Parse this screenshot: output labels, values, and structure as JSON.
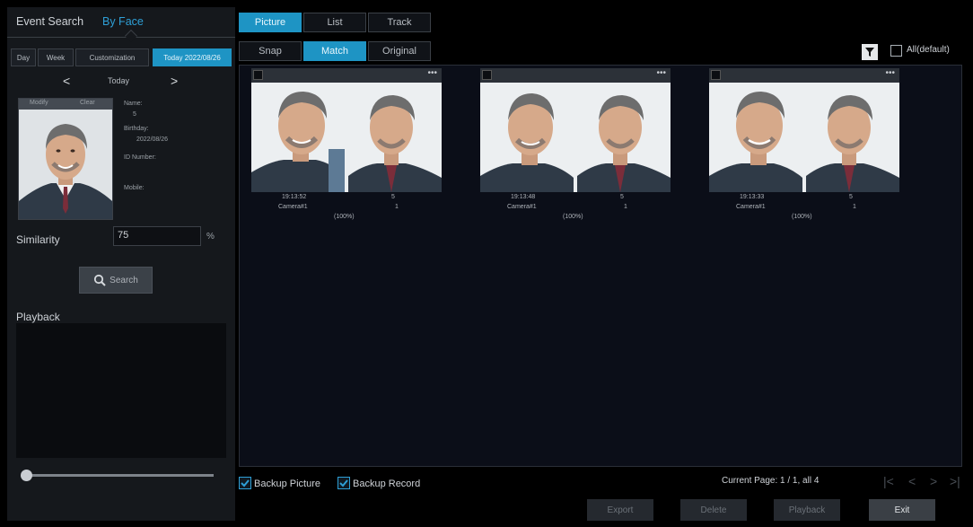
{
  "top_nav": {
    "event_search": "Event Search",
    "by_face": "By Face"
  },
  "range_tabs": [
    "Day",
    "Week",
    "Customization",
    "Today 2022/08/26"
  ],
  "day_nav": {
    "prev": "<",
    "label": "Today",
    "next": ">"
  },
  "target_person": {
    "modify": "Modify",
    "clear": "Clear",
    "name_label": "Name:",
    "name_value": "5",
    "birthday_label": "Birthday:",
    "birthday_value": "2022/08/26",
    "id_label": "ID Number:",
    "mobile_label": "Mobile:"
  },
  "similarity": {
    "label": "Similarity",
    "value": "75",
    "unit": "%"
  },
  "search_button": "Search",
  "playback_label": "Playback",
  "view_tabs": [
    "Picture",
    "List",
    "Track"
  ],
  "image_tabs": [
    "Snap",
    "Match",
    "Original"
  ],
  "all_default": "All(default)",
  "results": [
    {
      "time": "19:13:52",
      "id": "5",
      "camera": "Camera#1",
      "num": "1",
      "score": "(100%)"
    },
    {
      "time": "19:13:48",
      "id": "5",
      "camera": "Camera#1",
      "num": "1",
      "score": "(100%)"
    },
    {
      "time": "19:13:33",
      "id": "5",
      "camera": "Camera#1",
      "num": "1",
      "score": "(100%)"
    }
  ],
  "footer": {
    "backup_picture": "Backup Picture",
    "backup_record": "Backup Record",
    "page_info": "Current Page: 1 / 1, all 4"
  },
  "buttons": {
    "export": "Export",
    "delete": "Delete",
    "playback": "Playback",
    "exit": "Exit"
  },
  "colors": {
    "accent": "#1e94c4",
    "link": "#2e9fd6",
    "panel": "#15181c",
    "grid_bg": "#0b0e18"
  }
}
